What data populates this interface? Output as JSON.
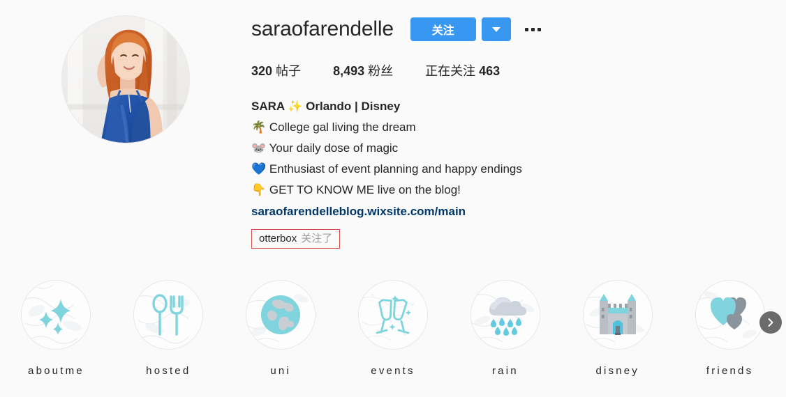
{
  "profile": {
    "username": "saraofarendelle",
    "avatar_alt": "profile-photo-woman-red-hair-blue-dress",
    "follow_label": "关注",
    "dropdown_icon": "chevron-down-icon",
    "options_icon": "ellipsis-icon",
    "stats": [
      {
        "number": "320",
        "label": "帖子",
        "order": "number-first"
      },
      {
        "number": "8,493",
        "label": "粉丝",
        "order": "number-first"
      },
      {
        "number": "463",
        "label": "正在关注",
        "order": "label-first"
      }
    ],
    "bio": {
      "name_line": "SARA ✨ Orlando | Disney",
      "lines": [
        "🌴 College gal living the dream",
        "🐭 Your daily dose of magic",
        "💙 Enthusiast of event planning and happy endings",
        "👇 GET TO KNOW ME live on the blog!"
      ],
      "link": "saraofarendelleblog.wixsite.com/main"
    },
    "annotation": {
      "name": "otterbox",
      "suffix": "关注了",
      "border_color": "#d94a4a"
    }
  },
  "highlights": {
    "items": [
      {
        "label": "aboutme",
        "icon": "sparkles-icon"
      },
      {
        "label": "hosted",
        "icon": "spoon-fork-icon"
      },
      {
        "label": "uni",
        "icon": "globe-icon"
      },
      {
        "label": "events",
        "icon": "champagne-glasses-icon"
      },
      {
        "label": "rain",
        "icon": "rain-cloud-icon"
      },
      {
        "label": "disney",
        "icon": "castle-icon"
      },
      {
        "label": "friends",
        "icon": "hearts-icon"
      }
    ],
    "next_icon": "chevron-right-icon"
  },
  "colors": {
    "brand_blue": "#3897f0",
    "link_blue": "#00376b",
    "text": "#262626",
    "muted": "#9b9b9b",
    "background": "#fafafa",
    "highlight_teal": "#7fd4dd",
    "highlight_gray": "#b9c0c7"
  }
}
